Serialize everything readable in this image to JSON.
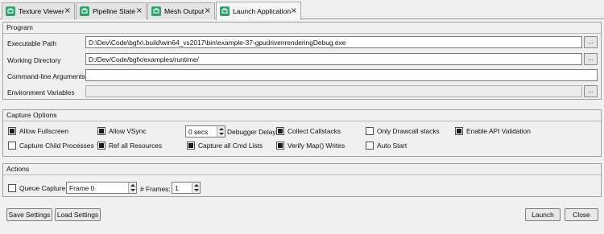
{
  "tabs": [
    {
      "label": "Texture Viewer",
      "close": "×",
      "icon": "window-icon",
      "active": false
    },
    {
      "label": "Pipeline State",
      "close": "×",
      "icon": "window-icon",
      "active": false
    },
    {
      "label": "Mesh Output",
      "close": "×",
      "icon": "window-icon",
      "active": false
    },
    {
      "label": "Launch Application",
      "close": "×",
      "icon": "window-icon",
      "active": true
    }
  ],
  "program": {
    "title": "Program",
    "executable_label": "Executable Path",
    "executable_value": "D:\\Dev\\Code\\bgfx\\.build\\win64_vs2017\\bin\\example-37-gpudrivenrenderingDebug.exe",
    "workdir_label": "Working Directory",
    "workdir_value": "D:/Dev/Code/bgfx/examples/runtime/",
    "cmdline_label": "Command-line Arguments",
    "cmdline_value": "",
    "env_label": "Environment Variables",
    "env_value": "",
    "browse_label": "..."
  },
  "capture": {
    "title": "Capture Options",
    "allow_fullscreen": "Allow Fullscreen",
    "allow_vsync": "Allow VSync",
    "debugger_delay_value": "0 secs",
    "debugger_delay_label": "Debugger Delay",
    "collect_callstacks": "Collect Callstacks",
    "only_drawcall_stacks": "Only Drawcall stacks",
    "enable_api_validation": "Enable API Validation",
    "capture_child": "Capture Child Processes",
    "ref_all_resources": "Ref all Resources",
    "capture_all_cmd": "Capture all Cmd Lists",
    "verify_map": "Verify Map() Writes",
    "auto_start": "Auto Start"
  },
  "actions": {
    "title": "Actions",
    "queue_capture": "Queue Capture",
    "frame_value": "Frame 0",
    "frames_label": "# Frames:",
    "frames_value": "1"
  },
  "footer": {
    "save_settings": "Save Settings",
    "load_settings": "Load Settings",
    "launch": "Launch",
    "close": "Close"
  }
}
